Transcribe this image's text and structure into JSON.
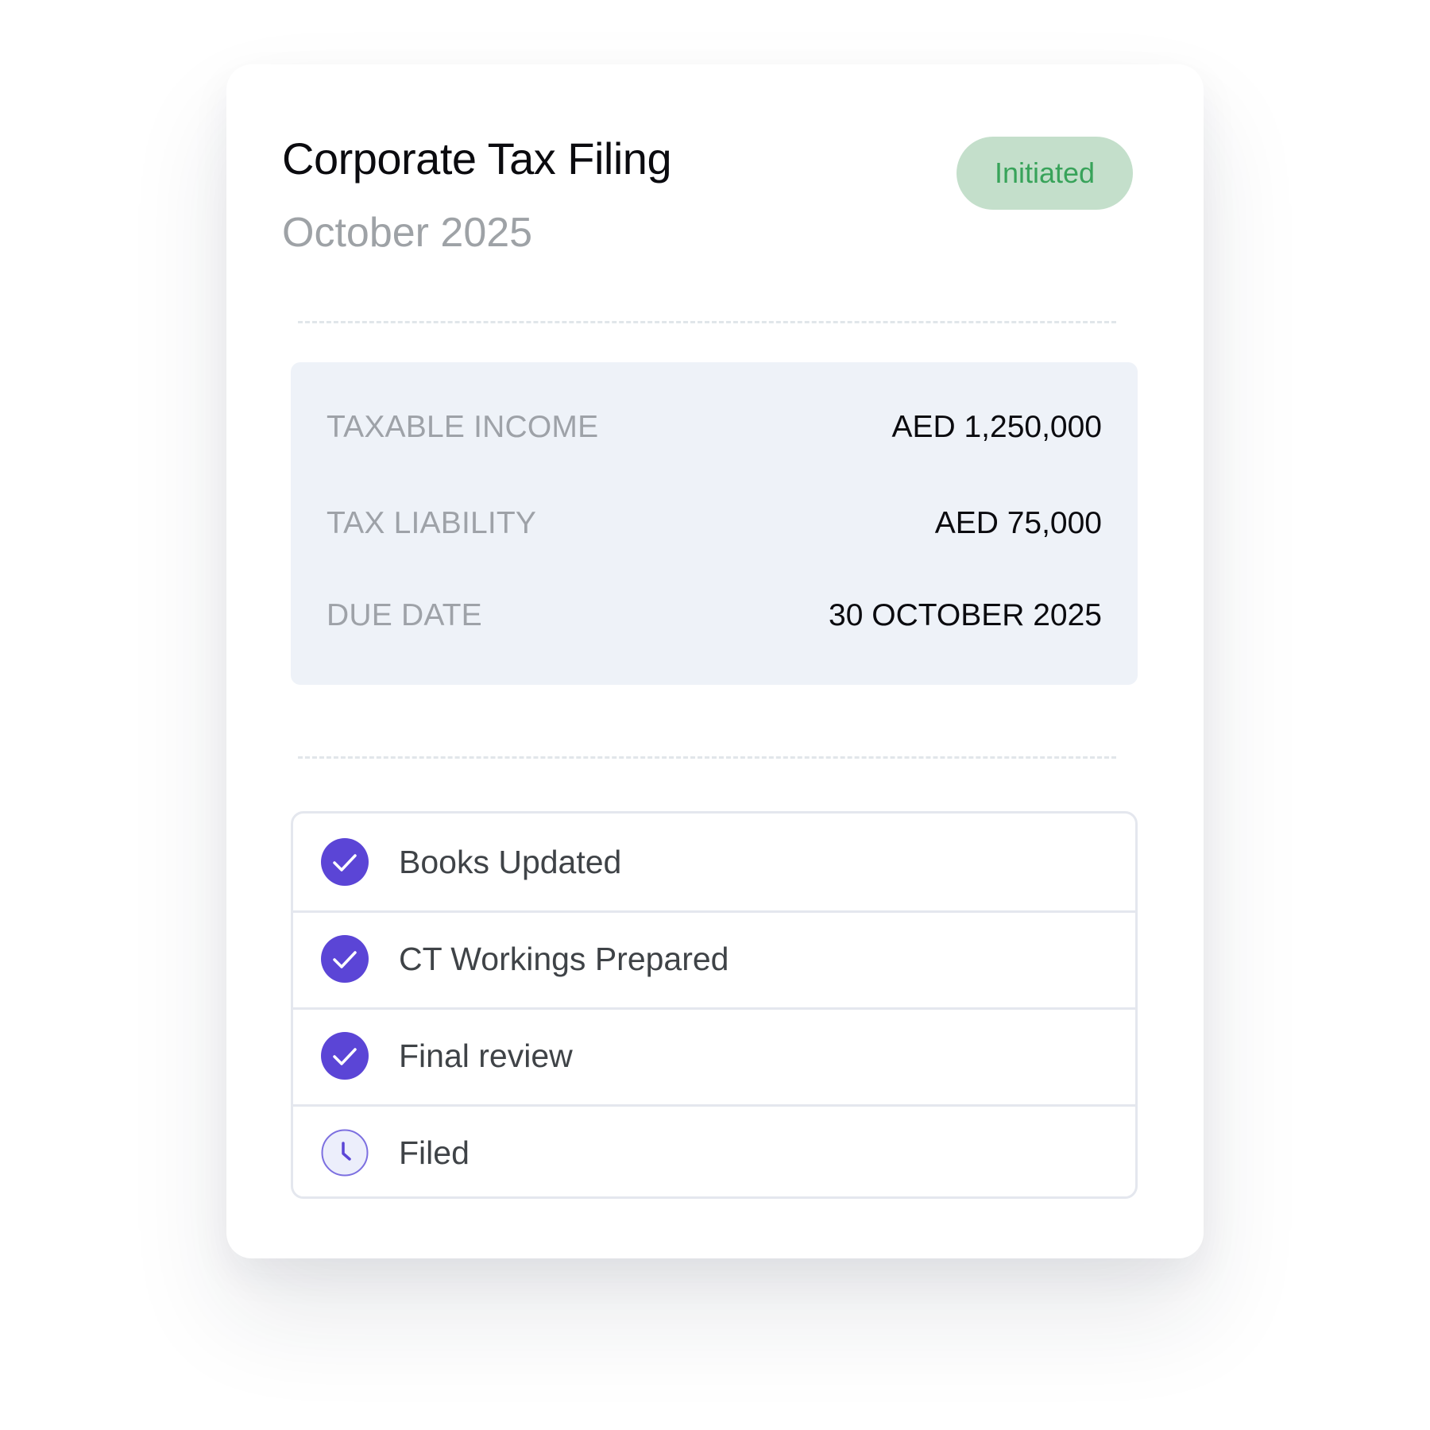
{
  "card": {
    "title": "Corporate Tax Filing",
    "period": "October 2025",
    "status": "Initiated",
    "status_color": "#38a35a",
    "status_bg": "#c4dfcb"
  },
  "summary": {
    "rows": [
      {
        "label": "TAXABLE INCOME",
        "value": "AED 1,250,000"
      },
      {
        "label": "TAX LIABILITY",
        "value": "AED 75,000"
      },
      {
        "label": "DUE DATE",
        "value": "30 OCTOBER 2025"
      }
    ]
  },
  "checklist": {
    "accent_color": "#5b45d6",
    "items": [
      {
        "label": "Books Updated",
        "state": "done",
        "icon": "check-circle-icon"
      },
      {
        "label": "CT Workings Prepared",
        "state": "done",
        "icon": "check-circle-icon"
      },
      {
        "label": "Final review",
        "state": "done",
        "icon": "check-circle-icon"
      },
      {
        "label": "Filed",
        "state": "pending",
        "icon": "clock-icon"
      }
    ]
  }
}
